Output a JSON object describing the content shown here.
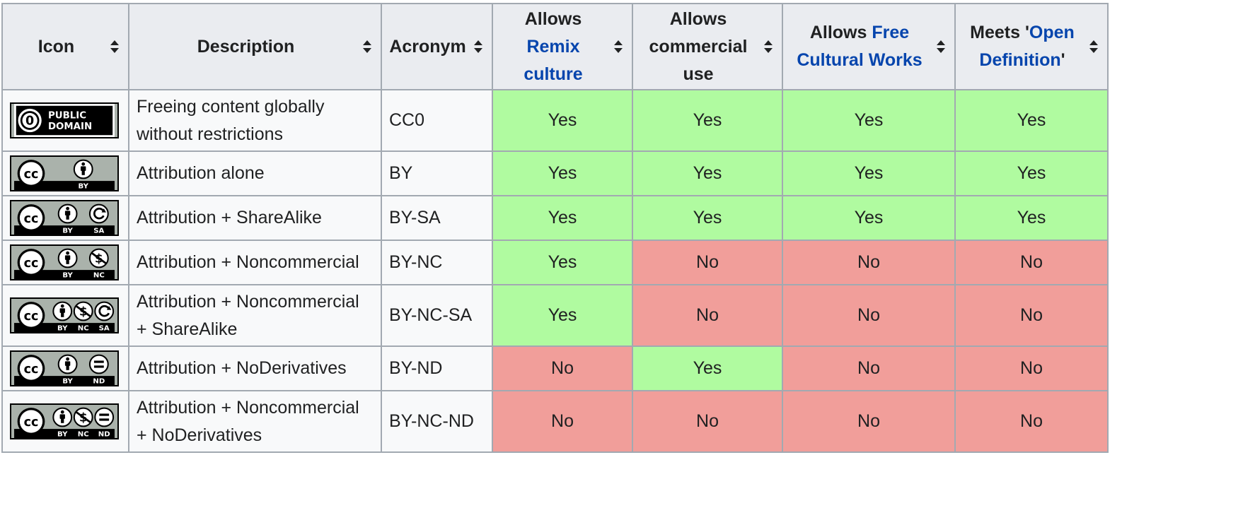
{
  "headers": [
    {
      "key": "icon",
      "text_before": "Icon",
      "link": "",
      "text_after": ""
    },
    {
      "key": "description",
      "text_before": "Description",
      "link": "",
      "text_after": ""
    },
    {
      "key": "acronym",
      "text_before": "Acronym",
      "link": "",
      "text_after": ""
    },
    {
      "key": "remix",
      "text_before": "Allows",
      "link": "Remix culture",
      "text_after": ""
    },
    {
      "key": "commercial",
      "text_before": "Allows commercial use",
      "link": "",
      "text_after": ""
    },
    {
      "key": "free",
      "text_before": "Allows",
      "link": "Free Cultural Works",
      "text_after": ""
    },
    {
      "key": "open",
      "text_before": "Meets '",
      "link": "Open Definition",
      "text_after": "'"
    }
  ],
  "rows": [
    {
      "icon": "cc0-public-domain-badge",
      "badge_text": [
        "PUBLIC",
        "DOMAIN"
      ],
      "labels": [],
      "description": "Freeing content globally without restrictions",
      "acronym": "CC0",
      "values": [
        "Yes",
        "Yes",
        "Yes",
        "Yes"
      ]
    },
    {
      "icon": "cc-by-badge",
      "badge_text": [],
      "labels": [
        "BY"
      ],
      "description": "Attribution alone",
      "acronym": "BY",
      "values": [
        "Yes",
        "Yes",
        "Yes",
        "Yes"
      ]
    },
    {
      "icon": "cc-by-sa-badge",
      "badge_text": [],
      "labels": [
        "BY",
        "SA"
      ],
      "description": "Attribution + ShareAlike",
      "acronym": "BY-SA",
      "values": [
        "Yes",
        "Yes",
        "Yes",
        "Yes"
      ]
    },
    {
      "icon": "cc-by-nc-badge",
      "badge_text": [],
      "labels": [
        "BY",
        "NC"
      ],
      "description": "Attribution + Noncommercial",
      "acronym": "BY-NC",
      "values": [
        "Yes",
        "No",
        "No",
        "No"
      ]
    },
    {
      "icon": "cc-by-nc-sa-badge",
      "badge_text": [],
      "labels": [
        "BY",
        "NC",
        "SA"
      ],
      "description": "Attribution + Noncommercial + ShareAlike",
      "acronym": "BY-NC-SA",
      "values": [
        "Yes",
        "No",
        "No",
        "No"
      ]
    },
    {
      "icon": "cc-by-nd-badge",
      "badge_text": [],
      "labels": [
        "BY",
        "ND"
      ],
      "description": "Attribution + NoDerivatives",
      "acronym": "BY-ND",
      "values": [
        "No",
        "Yes",
        "No",
        "No"
      ]
    },
    {
      "icon": "cc-by-nc-nd-badge",
      "badge_text": [],
      "labels": [
        "BY",
        "NC",
        "ND"
      ],
      "description": "Attribution + Noncommercial + NoDerivatives",
      "acronym": "BY-NC-ND",
      "values": [
        "No",
        "No",
        "No",
        "No"
      ]
    }
  ],
  "colors": {
    "yes": "#b0fba0",
    "no": "#f19e9a",
    "header_bg": "#eaecf0",
    "cell_bg": "#f8f9fa",
    "border": "#a2a9b1",
    "link": "#0645ad"
  }
}
